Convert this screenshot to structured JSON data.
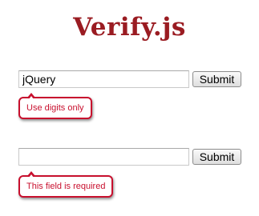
{
  "page": {
    "title": "Verify.js"
  },
  "form1": {
    "input_value": "jQuery",
    "submit_label": "Submit",
    "error": "Use digits only"
  },
  "form2": {
    "input_value": "",
    "submit_label": "Submit",
    "error": "This field is required"
  },
  "colors": {
    "title": "#9a1c22",
    "error": "#c8102e"
  }
}
